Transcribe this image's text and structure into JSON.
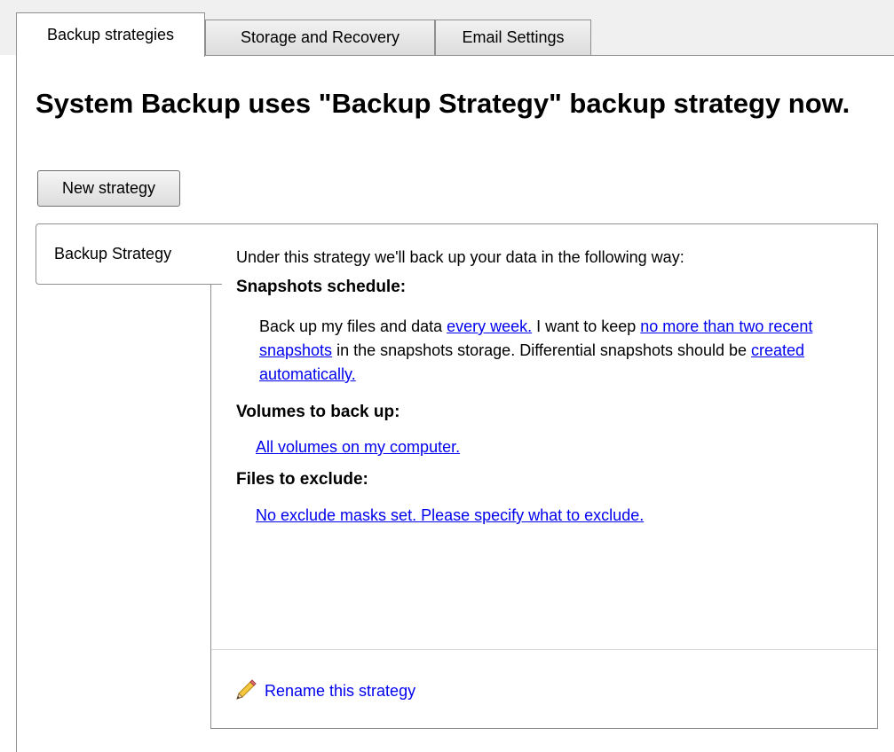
{
  "tabs": [
    {
      "label": "Backup strategies",
      "active": true
    },
    {
      "label": "Storage and Recovery",
      "active": false
    },
    {
      "label": "Email Settings",
      "active": false
    }
  ],
  "headline": "System Backup uses \"Backup Strategy\" backup strategy now.",
  "buttons": {
    "new_strategy": "New strategy"
  },
  "strategies": [
    {
      "label": "Backup Strategy",
      "selected": true
    }
  ],
  "detail": {
    "intro": "Under this strategy we'll back up your data in the following way:",
    "snapshots_heading": "Snapshots schedule:",
    "snapshots_text": {
      "part1": "Back up my files and data ",
      "link_frequency": "every week.",
      "part2": " I want to keep ",
      "link_keep": "no more than two recent snapshots",
      "part3": " in the snapshots storage. Differential snapshots should be ",
      "link_differential": "created automatically."
    },
    "volumes_heading": "Volumes to back up:",
    "volumes_link": "All volumes on my computer.",
    "exclude_heading": "Files to exclude:",
    "exclude_link": "No exclude masks set. Please specify what to exclude.",
    "rename_link": "Rename this strategy"
  },
  "icons": {
    "rename": "pencil-icon"
  },
  "colors": {
    "link": "#0000ee",
    "border": "#8e8f8f",
    "strip_bg": "#f0f0f0"
  }
}
